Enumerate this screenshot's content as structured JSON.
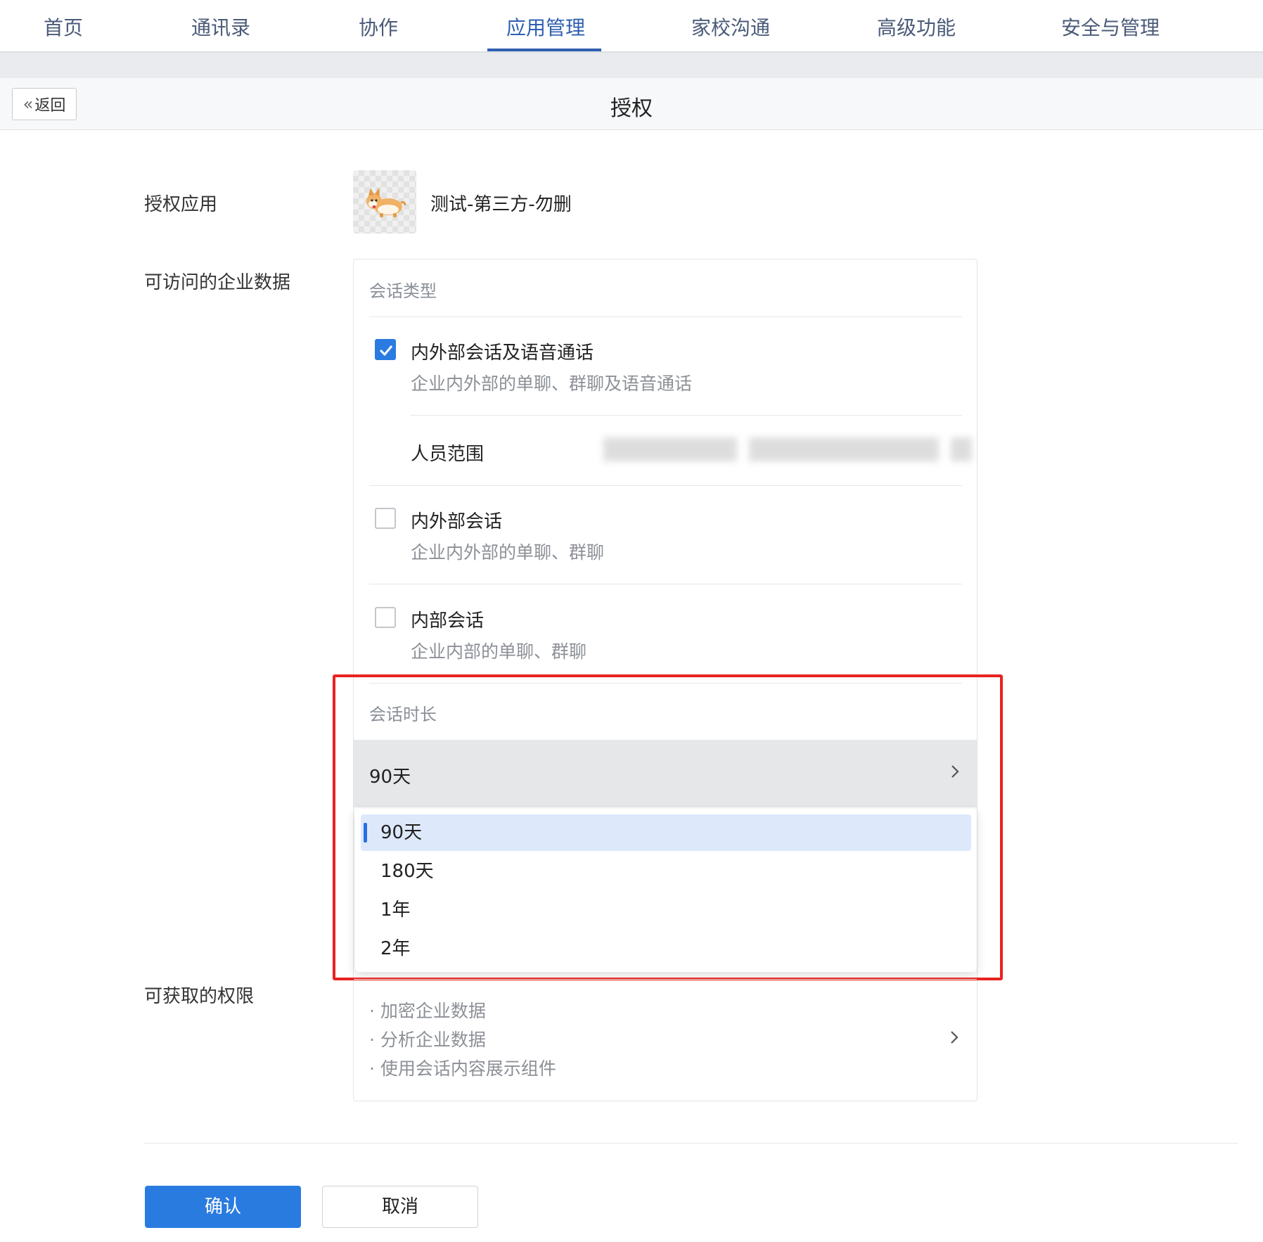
{
  "nav": {
    "tabs": [
      {
        "label": "首页"
      },
      {
        "label": "通讯录"
      },
      {
        "label": "协作"
      },
      {
        "label": "应用管理"
      },
      {
        "label": "家校沟通"
      },
      {
        "label": "高级功能"
      },
      {
        "label": "安全与管理"
      }
    ],
    "active": "应用管理"
  },
  "header": {
    "back_label": "返回",
    "title": "授权"
  },
  "form": {
    "app_label": "授权应用",
    "app_name": "测试-第三方-勿删",
    "data_label": "可访问的企业数据",
    "session_type_heading": "会话类型",
    "options": [
      {
        "title": "内外部会话及语音通话",
        "desc": "企业内外部的单聊、群聊及语音通话",
        "checked": true
      },
      {
        "title": "内外部会话",
        "desc": "企业内外部的单聊、群聊",
        "checked": false
      },
      {
        "title": "内部会话",
        "desc": "企业内部的单聊、群聊",
        "checked": false
      }
    ],
    "scope_label": "人员范围",
    "duration_heading": "会话时长",
    "duration_value": "90天",
    "duration_options": [
      "90天",
      "180天",
      "1年",
      "2年"
    ],
    "permissions_label": "可获取的权限",
    "permissions": [
      "· 加密企业数据",
      "· 分析企业数据",
      "· 使用会话内容展示组件"
    ]
  },
  "footer": {
    "confirm_label": "确认",
    "cancel_label": "取消"
  },
  "colors": {
    "accent": "#2a7be0",
    "nav_active": "#2f5fb0",
    "highlight_box": "#e8231f"
  }
}
